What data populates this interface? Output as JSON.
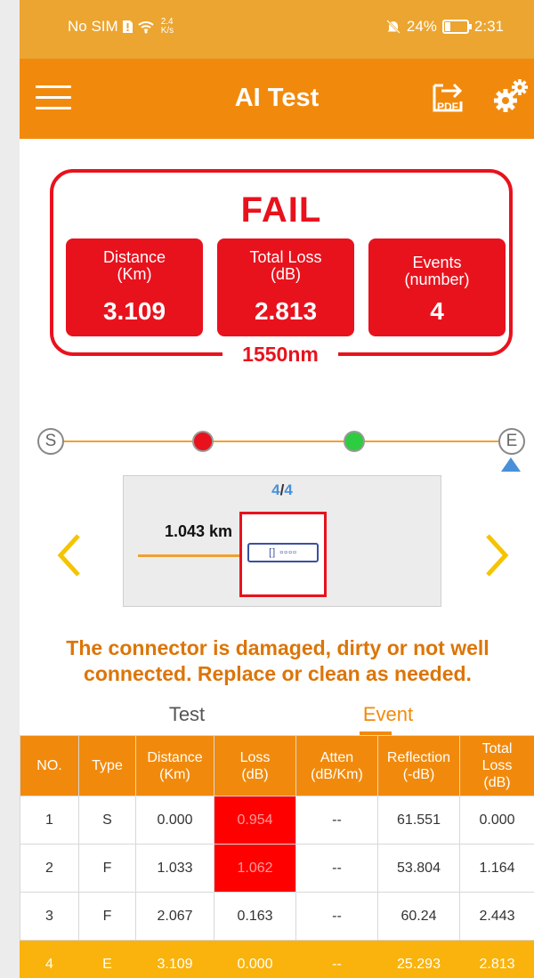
{
  "status_bar": {
    "carrier": "No SIM",
    "speed_value": "2.4",
    "speed_unit": "K/s",
    "battery": "24%",
    "battery_level": 0.24,
    "time": "2:31"
  },
  "app_bar": {
    "title": "AI Test",
    "pdf_label": "PDF"
  },
  "result": {
    "verdict": "FAIL",
    "wavelength": "1550nm",
    "distance_label": "Distance\n(Km)",
    "distance_value": "3.109",
    "loss_label": "Total Loss\n(dB)",
    "loss_value": "2.813",
    "events_label": "Events\n(number)",
    "events_value": "4"
  },
  "event_line": {
    "start": "S",
    "end": "E",
    "dot_colors": [
      "#e8121d",
      "#2ecc40"
    ]
  },
  "event_panel": {
    "current": "4",
    "separator": "/",
    "total": "4",
    "distance": "1.043 km",
    "connector_glyph": "[] ▫▫▫▫"
  },
  "message": "The connector is damaged, dirty or not well connected. Replace or clean as needed.",
  "tabs": {
    "test": "Test",
    "event": "Event"
  },
  "table": {
    "headers": [
      "NO.",
      "Type",
      "Distance\n(Km)",
      "Loss\n(dB)",
      "Atten\n(dB/Km)",
      "Reflection\n(-dB)",
      "Total\nLoss\n(dB)"
    ],
    "rows": [
      [
        "1",
        "S",
        "0.000",
        "0.954",
        "--",
        "61.551",
        "0.000"
      ],
      [
        "2",
        "F",
        "1.033",
        "1.062",
        "--",
        "53.804",
        "1.164"
      ],
      [
        "3",
        "F",
        "2.067",
        "0.163",
        "--",
        "60.24",
        "2.443"
      ],
      [
        "4",
        "E",
        "3.109",
        "0.000",
        "--",
        "25.293",
        "2.813"
      ]
    ]
  },
  "colors": {
    "accent": "#f18a0c",
    "fail": "#e8121d",
    "selected_row": "#f9b30c"
  }
}
